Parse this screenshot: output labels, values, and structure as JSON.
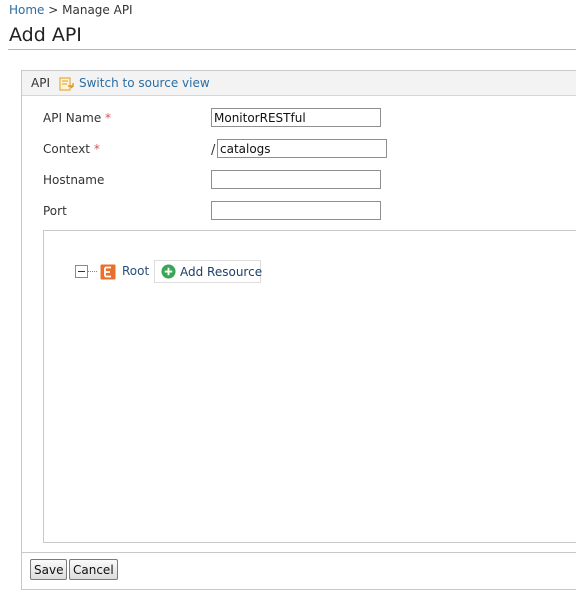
{
  "breadcrumb": {
    "home": "Home",
    "separator": " > ",
    "current": "Manage API"
  },
  "page": {
    "title": "Add API"
  },
  "panel": {
    "header_label": "API",
    "source_link": "Switch to source view",
    "source_icon": "switch-source-icon"
  },
  "form": {
    "api_name": {
      "label": "API Name",
      "required": "*",
      "value": "MonitorRESTful"
    },
    "context": {
      "label": "Context",
      "required": "*",
      "prefix": "/",
      "value": "catalogs"
    },
    "hostname": {
      "label": "Hostname",
      "value": ""
    },
    "port": {
      "label": "Port",
      "value": ""
    }
  },
  "tree": {
    "collapse_icon": "minus-collapse-icon",
    "root_icon": "element-icon",
    "root_label": "Root",
    "add_resource_label": "Add Resource",
    "add_resource_icon": "plus-circle-icon"
  },
  "buttons": {
    "save": "Save",
    "cancel": "Cancel"
  },
  "colors": {
    "link": "#2b6da3",
    "required": "#d9534f",
    "root_icon": "#e8702a",
    "add_icon": "#3aa655"
  }
}
